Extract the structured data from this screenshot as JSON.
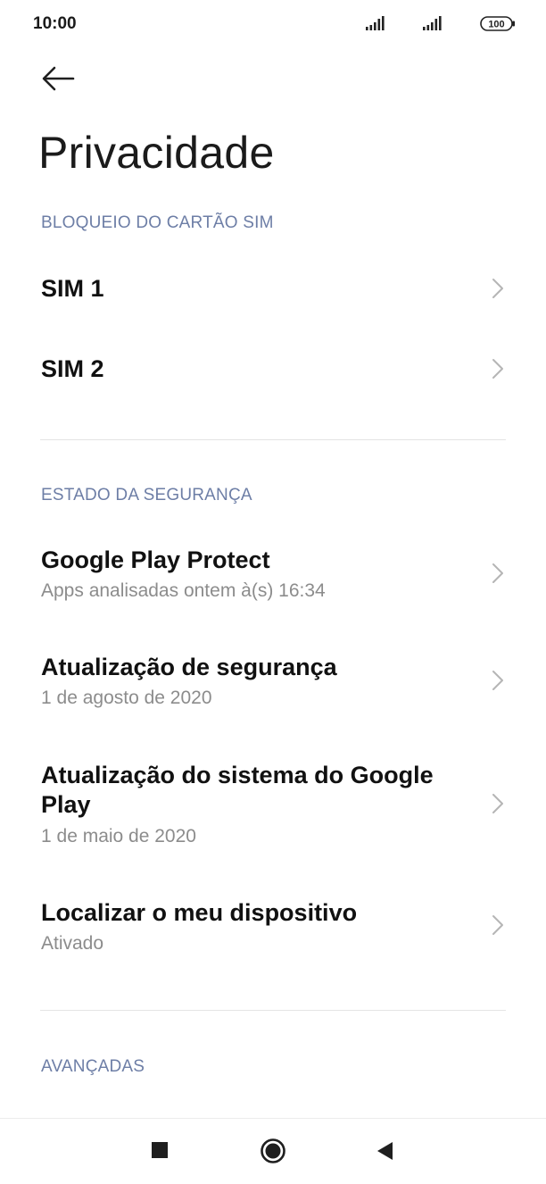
{
  "status_bar": {
    "time": "10:00",
    "battery": "100"
  },
  "header": {
    "title": "Privacidade"
  },
  "sections": {
    "sim_lock": {
      "header": "BLOQUEIO DO CARTÃO SIM",
      "items": [
        {
          "title": "SIM 1"
        },
        {
          "title": "SIM 2"
        }
      ]
    },
    "security_status": {
      "header": "ESTADO DA SEGURANÇA",
      "items": [
        {
          "title": "Google Play Protect",
          "subtitle": "Apps analisadas ontem à(s) 16:34"
        },
        {
          "title": "Atualização de segurança",
          "subtitle": "1 de agosto de 2020"
        },
        {
          "title": "Atualização do sistema do Google Play",
          "subtitle": "1 de maio de 2020"
        },
        {
          "title": "Localizar o meu dispositivo",
          "subtitle": "Ativado"
        }
      ]
    },
    "advanced": {
      "header": "AVANÇADAS"
    }
  },
  "icons": {
    "back": "arrow-left-icon",
    "chevron": "chevron-right-icon",
    "nav_recent": "square-icon",
    "nav_home": "circle-icon",
    "nav_back": "triangle-icon"
  },
  "colors": {
    "section_header": "#6d7ea6",
    "subtitle": "#8c8c8c",
    "title": "#111111"
  }
}
